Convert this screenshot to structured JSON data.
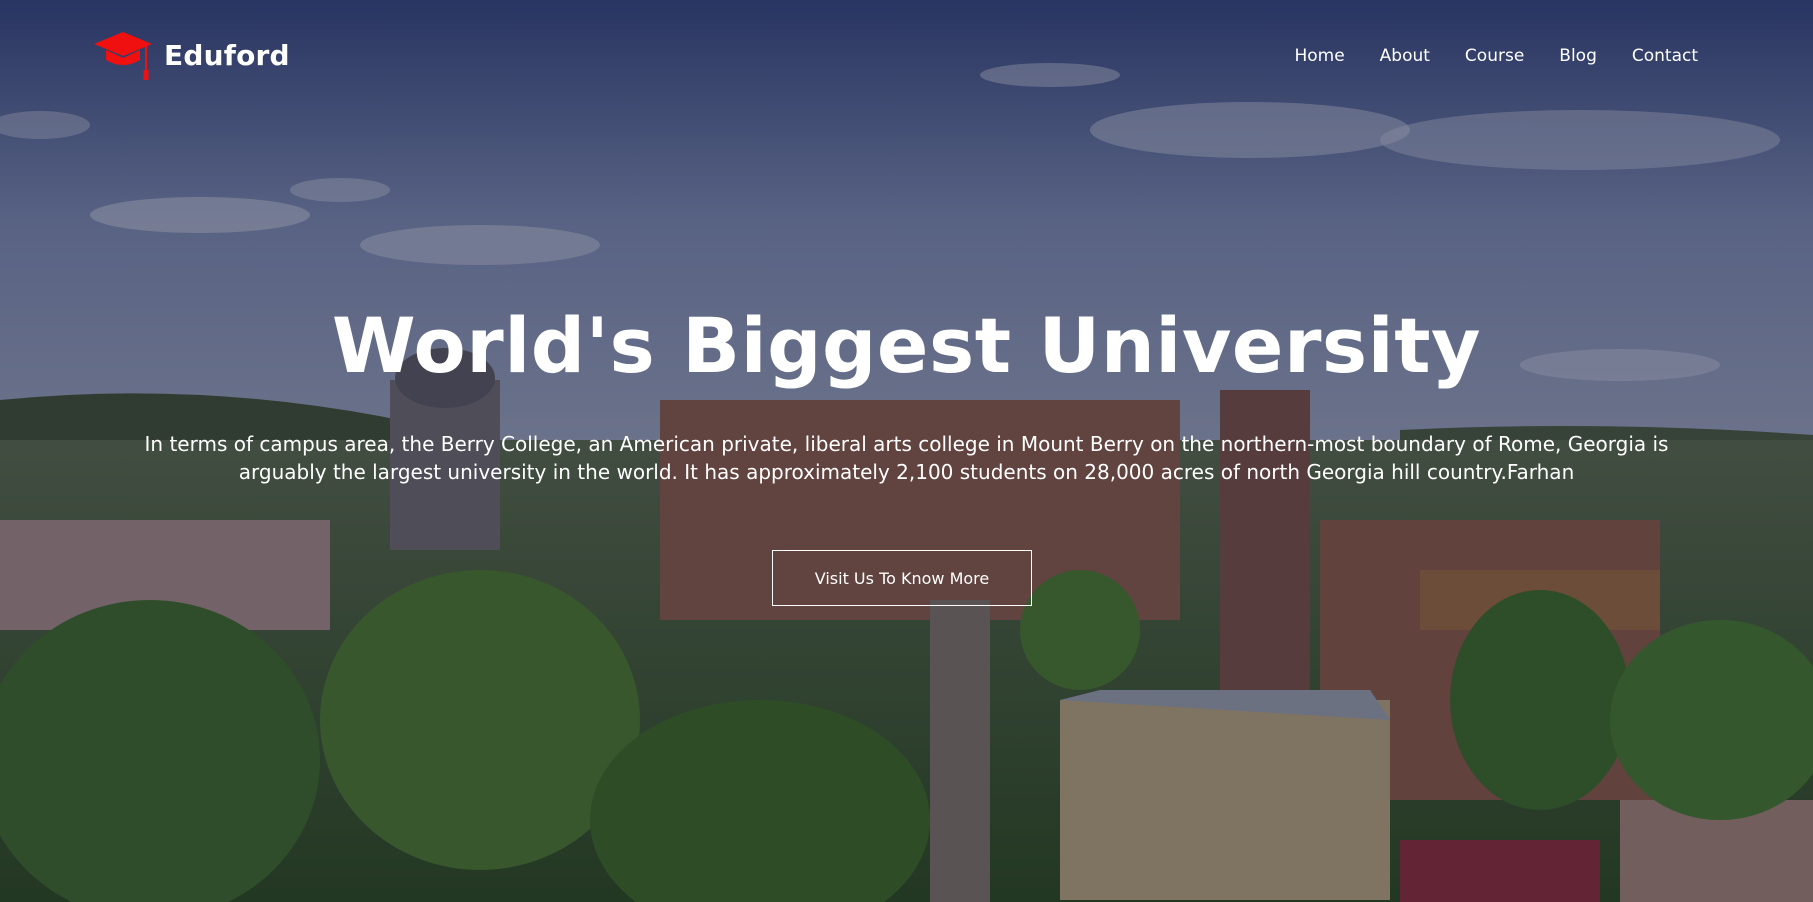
{
  "brand": {
    "name": "Eduford",
    "logo_icon": "graduation-cap-icon",
    "logo_color": "#f01010"
  },
  "nav": {
    "items": [
      {
        "label": "Home"
      },
      {
        "label": "About"
      },
      {
        "label": "Course"
      },
      {
        "label": "Blog"
      },
      {
        "label": "Contact"
      }
    ]
  },
  "hero": {
    "title": "World's Biggest University",
    "description": "In terms of campus area, the Berry College, an American private, liberal arts college in Mount Berry on the northern-most boundary of Rome, Georgia is arguably the largest university in the world. It has approximately 2,100 students on 28,000 acres of north Georgia hill country.Farhan",
    "cta_label": "Visit Us To Know More"
  }
}
